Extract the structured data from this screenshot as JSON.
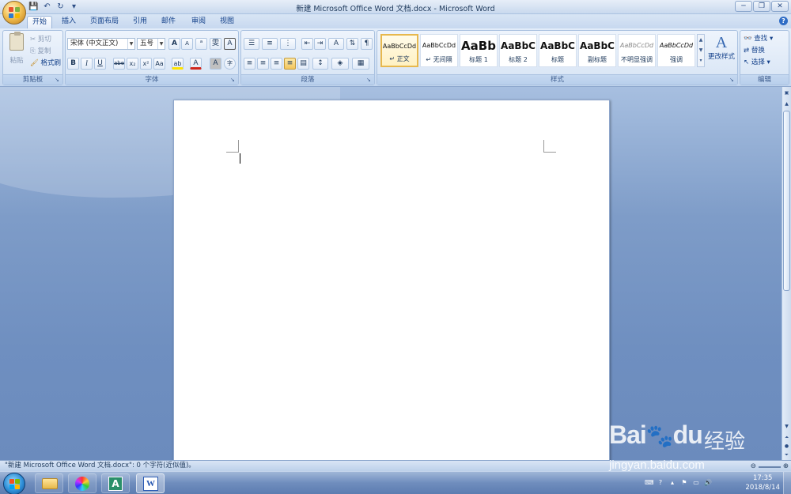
{
  "window": {
    "title": "新建 Microsoft Office Word 文档.docx - Microsoft Word",
    "controls": [
      "─",
      "❐",
      "✕"
    ]
  },
  "quick_access": {
    "save": "💾",
    "undo": "↶",
    "redo": "↻",
    "more": "▾"
  },
  "tabs": [
    {
      "label": "开始",
      "active": true
    },
    {
      "label": "插入"
    },
    {
      "label": "页面布局"
    },
    {
      "label": "引用"
    },
    {
      "label": "邮件"
    },
    {
      "label": "审阅"
    },
    {
      "label": "视图"
    }
  ],
  "clipboard": {
    "group_label": "剪贴板",
    "paste": "粘贴",
    "cut": "剪切",
    "copy": "复制",
    "format_painter": "格式刷"
  },
  "font": {
    "group_label": "字体",
    "font_name": "宋体 (中文正文)",
    "font_size": "五号",
    "grow": "A",
    "shrink": "A",
    "clear": "ᵃ",
    "phonetic": "雯",
    "border": "A",
    "bold": "B",
    "italic": "I",
    "underline": "U",
    "strike": "abe",
    "subscript": "x₂",
    "superscript": "x²",
    "case": "Aa",
    "highlight": "ab",
    "font_color": "A",
    "shading": "A",
    "enclose": "字"
  },
  "paragraph": {
    "group_label": "段落"
  },
  "styles": {
    "group_label": "样式",
    "items": [
      {
        "sample": "AaBbCcDd",
        "name": "↵ 正文",
        "selected": true
      },
      {
        "sample": "AaBbCcDd",
        "name": "↵ 无间隔"
      },
      {
        "sample": "AaBb",
        "name": "标题 1"
      },
      {
        "sample": "AaBbC",
        "name": "标题 2"
      },
      {
        "sample": "AaBbC",
        "name": "标题"
      },
      {
        "sample": "AaBbC",
        "name": "副标题"
      },
      {
        "sample": "AaBbCcDd",
        "name": "不明显强调"
      },
      {
        "sample": "AaBbCcDd",
        "name": "强调"
      }
    ],
    "change_styles": "更改样式"
  },
  "editing": {
    "group_label": "编辑",
    "find": "查找",
    "replace": "替换",
    "select": "选择"
  },
  "status": {
    "text": "\"新建 Microsoft Office Word 文档.docx\": 0 个字符(近似值)。"
  },
  "taskbar": {
    "time": "17:35",
    "date": "2018/8/14"
  },
  "watermark": {
    "brand": "Bai",
    "brand2": "du",
    "suffix": "经验",
    "url": "jingyan.baidu.com"
  },
  "colors": {
    "ribbon_bg": "#d1e0f3",
    "doc_bg": "#7e9cc8",
    "accent": "#15428b",
    "highlight_yellow": "#f3c55c",
    "font_red": "#d0261d"
  }
}
